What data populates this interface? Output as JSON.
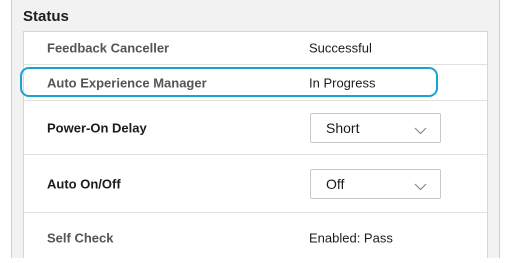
{
  "panel": {
    "title": "Status"
  },
  "rows": [
    {
      "label": "Feedback Canceller",
      "value": "Successful"
    },
    {
      "label": "Auto Experience Manager",
      "value": "In Progress"
    },
    {
      "label": "Power-On Delay",
      "selected": "Short"
    },
    {
      "label": "Auto On/Off",
      "selected": "Off"
    },
    {
      "label": "Self Check",
      "value": "Enabled: Pass"
    }
  ],
  "colors": {
    "highlight": "#1aa3d3",
    "panel_background": "#f2f2f2"
  },
  "icons": {
    "dropdown": "chevron-down-icon"
  }
}
